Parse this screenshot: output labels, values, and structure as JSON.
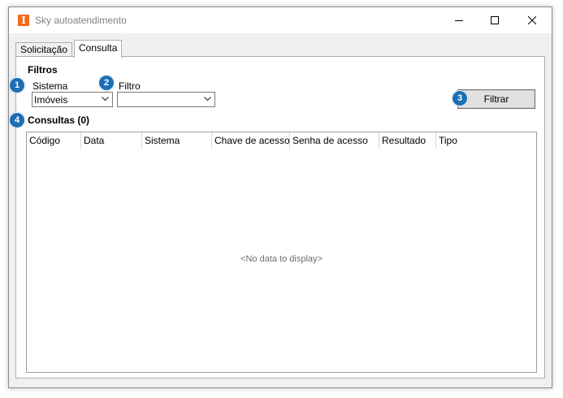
{
  "window": {
    "title": "Sky autoatendimento",
    "icon": "app-logo-icon",
    "app_icon_letter": "I",
    "accent_color": "#f26a1b"
  },
  "tabs": [
    {
      "label": "Solicitação",
      "active": false
    },
    {
      "label": "Consulta",
      "active": true
    }
  ],
  "filtros": {
    "title": "Filtros",
    "sistema_label": "Sistema",
    "sistema_value": "Imóveis",
    "filtro_label": "Filtro",
    "filtro_value": "",
    "filter_button_label": "Filtrar"
  },
  "consultas": {
    "title": "Consultas (0)",
    "columns": [
      "Código",
      "Data",
      "Sistema",
      "Chave de acesso",
      "Senha de acesso",
      "Resultado",
      "Tipo"
    ],
    "empty_text": "<No data to display>"
  },
  "badges": [
    "1",
    "2",
    "3",
    "4"
  ],
  "badge_color": "#1b6fb5"
}
